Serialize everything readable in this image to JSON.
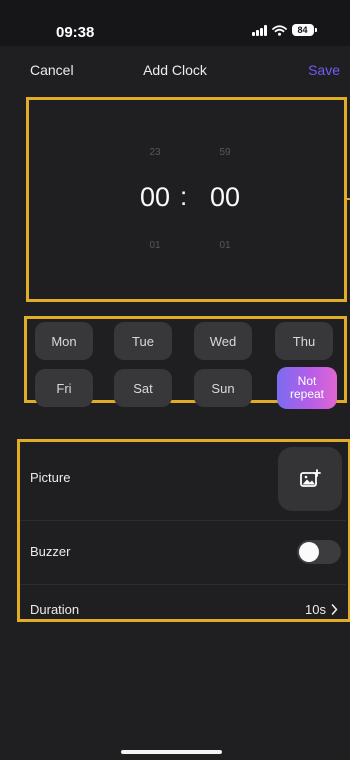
{
  "status_bar": {
    "time": "09:38",
    "battery": "84"
  },
  "nav": {
    "cancel_label": "Cancel",
    "title": "Add Clock",
    "save_label": "Save"
  },
  "picker": {
    "hours": {
      "prev": "23",
      "current": "00",
      "next": "01"
    },
    "minutes": {
      "prev": "59",
      "current": "00",
      "next": "01"
    },
    "separator": ":"
  },
  "days": [
    {
      "label": "Mon",
      "selected": false
    },
    {
      "label": "Tue",
      "selected": false
    },
    {
      "label": "Wed",
      "selected": false
    },
    {
      "label": "Thu",
      "selected": false
    },
    {
      "label": "Fri",
      "selected": false
    },
    {
      "label": "Sat",
      "selected": false
    },
    {
      "label": "Sun",
      "selected": false
    },
    {
      "label": "Not\nrepeat",
      "selected": true
    }
  ],
  "settings": {
    "picture_label": "Picture",
    "buzzer_label": "Buzzer",
    "buzzer_on": false,
    "duration_label": "Duration",
    "duration_value": "10s"
  },
  "colors": {
    "accent": "#6f5cf6",
    "highlight": "#e2ad26",
    "background": "#1f1f21",
    "selected_gradient": [
      "#7a6cf0",
      "#e066d0"
    ]
  },
  "icons": {
    "signal": "signal-icon",
    "wifi": "wifi-icon",
    "battery": "battery-icon",
    "picture": "add-image-icon",
    "chevron": "chevron-right-icon"
  }
}
